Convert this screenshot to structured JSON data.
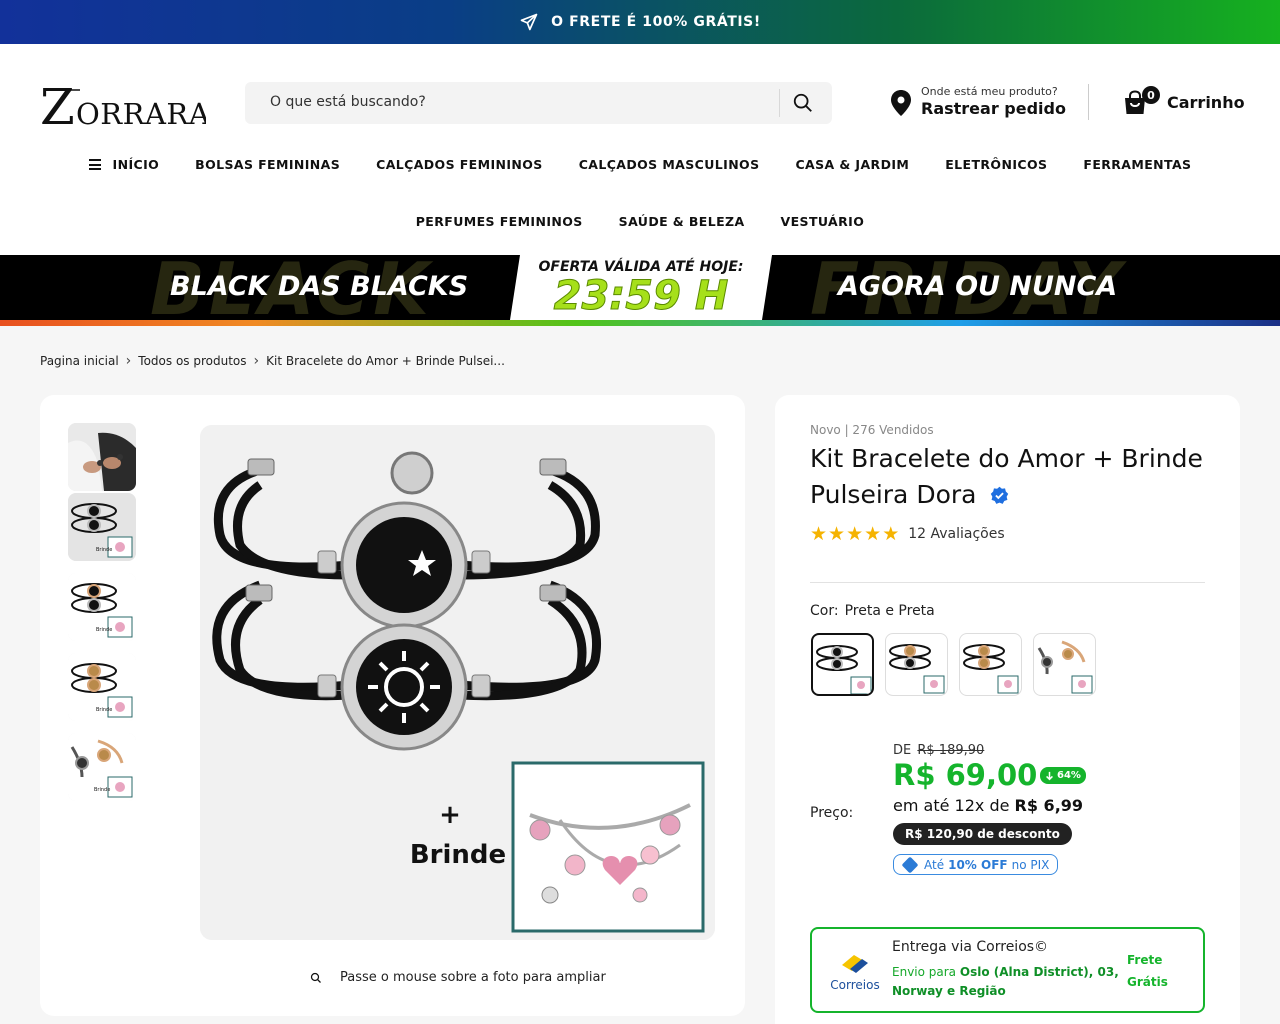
{
  "announcement": {
    "text": "O FRETE É 100% GRÁTIS!",
    "icon": "paper-plane-icon"
  },
  "header": {
    "logo_text": "ZORRARA",
    "search_placeholder": "O que está buscando?",
    "track_small": "Onde está meu produto?",
    "track_big": "Rastrear pedido",
    "cart_count": "0",
    "cart_label": "Carrinho"
  },
  "nav": {
    "row1": [
      "INÍCIO",
      "BOLSAS FEMININAS",
      "CALÇADOS FEMININOS",
      "CALÇADOS MASCULINOS",
      "CASA & JARDIM",
      "ELETRÔNICOS",
      "FERRAMENTAS"
    ],
    "row2": [
      "PERFUMES FEMININOS",
      "SAÚDE & BELEZA",
      "VESTUÁRIO"
    ]
  },
  "promo": {
    "watermark_left": "BLACK",
    "watermark_right": "FRIDAY",
    "left": "BLACK DAS BLACKS",
    "center_top": "OFERTA VÁLIDA ATÉ HOJE:",
    "center_time": "23:59 H",
    "right": "AGORA OU NUNCA"
  },
  "breadcrumb": [
    "Pagina inicial",
    "Todos os produtos",
    "Kit Bracelete do Amor + Brinde Pulsei..."
  ],
  "gallery": {
    "zoom_hint": "Passe o mouse sobre a foto para ampliar",
    "brinde_label": "Brinde",
    "plus": "+",
    "thumb_caption": "Brinde"
  },
  "product": {
    "meta": "Novo | 276 Vendidos",
    "title": "Kit Bracelete do Amor + Brinde Pulseira Dora",
    "rating": 5,
    "reviews": "12 Avaliações",
    "color_label": "Cor:",
    "color_value": "Preta e Preta",
    "price_label": "Preço:",
    "old_prefix": "DE",
    "old_price": "R$ 189,90",
    "price": "R$ 69,00",
    "discount_pct": "64%",
    "installments_prefix": "em até 12x de",
    "installment_value": "R$ 6,99",
    "discount_amount": "R$ 120,90 de desconto",
    "pix_prefix": "Até",
    "pix_off": "10% OFF",
    "pix_suffix": "no PIX"
  },
  "shipping": {
    "carrier_logo": "Correios",
    "title": "Entrega via Correios©",
    "to_prefix": "Envio para",
    "destination": "Oslo (Alna District), 03, Norway e Região",
    "free": "Frete Grátis"
  },
  "colors": {
    "green": "#15b42c",
    "pix_blue": "#2b7bd6",
    "promo_accent": "#a6e01a"
  }
}
